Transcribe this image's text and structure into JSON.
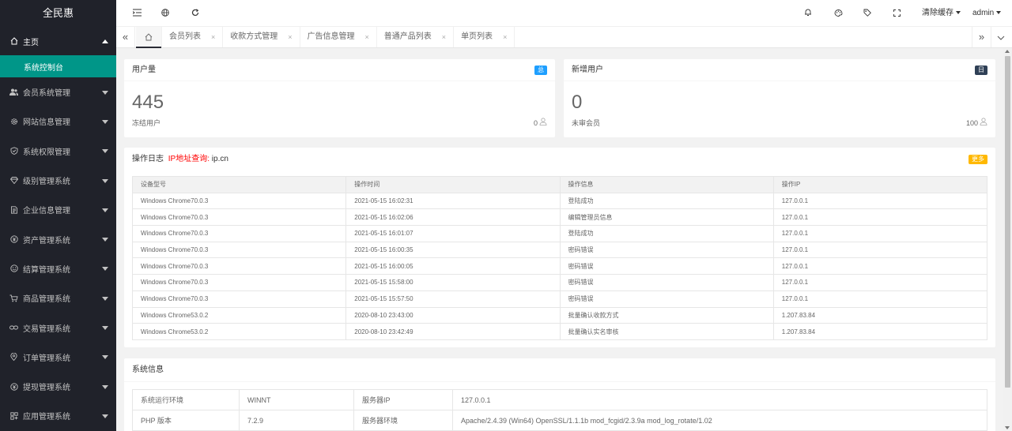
{
  "app": {
    "title": "全民惠"
  },
  "sidebar": {
    "home": {
      "label": "主页",
      "icon": "home-icon"
    },
    "home_sub": {
      "label": "系统控制台"
    },
    "items": [
      {
        "label": "会员系统管理",
        "icon": "users-icon"
      },
      {
        "label": "网站信息管理",
        "icon": "gear-icon"
      },
      {
        "label": "系统权限管理",
        "icon": "shield-icon"
      },
      {
        "label": "级别管理系统",
        "icon": "diamond-icon"
      },
      {
        "label": "企业信息管理",
        "icon": "document-icon"
      },
      {
        "label": "资产管理系统",
        "icon": "coin-icon"
      },
      {
        "label": "结算管理系统",
        "icon": "smile-icon"
      },
      {
        "label": "商品管理系统",
        "icon": "cart-icon"
      },
      {
        "label": "交易管理系统",
        "icon": "link-icon"
      },
      {
        "label": "订单管理系统",
        "icon": "location-icon"
      },
      {
        "label": "提现管理系统",
        "icon": "coin-icon"
      },
      {
        "label": "应用管理系统",
        "icon": "apps-icon"
      }
    ]
  },
  "header": {
    "clear_cache": "清除缓存",
    "user": "admin"
  },
  "tabs": [
    {
      "label": "会员列表"
    },
    {
      "label": "收款方式管理"
    },
    {
      "label": "广告信息管理"
    },
    {
      "label": "普通产品列表"
    },
    {
      "label": "单页列表"
    }
  ],
  "stats": {
    "users": {
      "title": "用户量",
      "badge": "总",
      "value": "445",
      "sub_label": "冻结用户",
      "sub_value": "0"
    },
    "new_users": {
      "title": "新增用户",
      "badge": "日",
      "value": "0",
      "sub_label": "未审会员",
      "sub_value": "100"
    }
  },
  "log": {
    "title": "操作日志",
    "ip_link": "IP地址查询",
    "ip_site": "ip.cn",
    "more": "更多",
    "columns": [
      "设备型号",
      "操作时间",
      "操作信息",
      "操作IP"
    ],
    "rows": [
      [
        "Windows Chrome70.0.3",
        "2021-05-15 16:02:31",
        "登陆成功",
        "127.0.0.1"
      ],
      [
        "Windows Chrome70.0.3",
        "2021-05-15 16:02:06",
        "编辑管理员信息",
        "127.0.0.1"
      ],
      [
        "Windows Chrome70.0.3",
        "2021-05-15 16:01:07",
        "登陆成功",
        "127.0.0.1"
      ],
      [
        "Windows Chrome70.0.3",
        "2021-05-15 16:00:35",
        "密码错误",
        "127.0.0.1"
      ],
      [
        "Windows Chrome70.0.3",
        "2021-05-15 16:00:05",
        "密码错误",
        "127.0.0.1"
      ],
      [
        "Windows Chrome70.0.3",
        "2021-05-15 15:58:00",
        "密码错误",
        "127.0.0.1"
      ],
      [
        "Windows Chrome70.0.3",
        "2021-05-15 15:57:50",
        "密码错误",
        "127.0.0.1"
      ],
      [
        "Windows Chrome53.0.2",
        "2020-08-10 23:43:00",
        "批量确认收款方式",
        "1.207.83.84"
      ],
      [
        "Windows Chrome53.0.2",
        "2020-08-10 23:42:49",
        "批量确认实名审核",
        "1.207.83.84"
      ]
    ]
  },
  "sysinfo": {
    "title": "系统信息",
    "rows": [
      [
        "系统运行环境",
        "WINNT",
        "服务器IP",
        "127.0.0.1"
      ],
      [
        "PHP 版本",
        "7.2.9",
        "服务器环境",
        "Apache/2.4.39 (Win64) OpenSSL/1.1.1b mod_fcgid/2.3.9a mod_log_rotate/1.02"
      ]
    ]
  },
  "colors": {
    "sidebar_bg": "#20222a",
    "accent": "#009688",
    "badge_blue": "#1e9fff",
    "badge_dark": "#2f4056",
    "badge_orange": "#ffb800",
    "link_red": "#ff0000"
  }
}
